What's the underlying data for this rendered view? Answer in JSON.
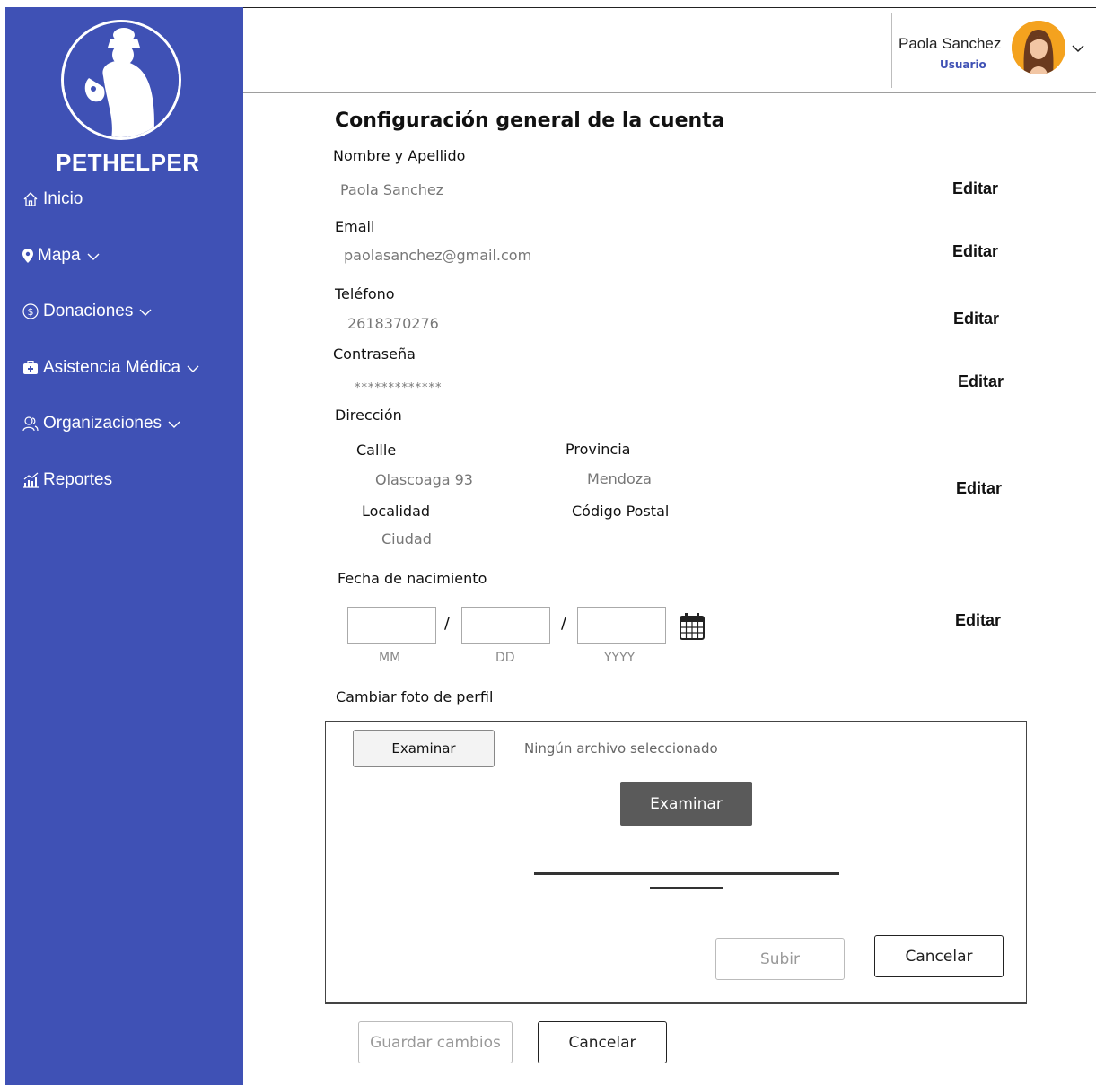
{
  "sidebar": {
    "logo_text": "PETHELPER",
    "items": [
      {
        "label": "Inicio",
        "icon": "home-icon"
      },
      {
        "label": "Mapa",
        "icon": "map-pin-icon"
      },
      {
        "label": "Donaciones",
        "icon": "dollar-coin-icon"
      },
      {
        "label": "Asistencia Médica",
        "icon": "medical-kit-icon"
      },
      {
        "label": "Organizaciones",
        "icon": "people-icon"
      },
      {
        "label": "Reportes",
        "icon": "chart-icon"
      }
    ]
  },
  "header": {
    "user_name": "Paola Sanchez",
    "user_role": "Usuario"
  },
  "main": {
    "title": "Configuración general de la cuenta",
    "name_label": "Nombre y Apellido",
    "name_value": "Paola Sanchez",
    "email_label": "Email",
    "email_value": "paolasanchez@gmail.com",
    "phone_label": "Teléfono",
    "phone_value": "2618370276",
    "password_label": "Contraseña",
    "password_value": "*************",
    "address_label": "Dirección",
    "street_label": "Callle",
    "street_value": "Olascoaga 93",
    "province_label": "Provincia",
    "province_value": "Mendoza",
    "locality_label": "Localidad",
    "locality_value": "Ciudad",
    "postal_label": "Código Postal",
    "birth_label": "Fecha de nacimiento",
    "date_sep": "/",
    "date_mm": "MM",
    "date_dd": "DD",
    "date_yyyy": "YYYY",
    "edit_label": "Editar",
    "photo_label": "Cambiar foto de perfil",
    "upload": {
      "file_button": "Examinar",
      "no_file": "Ningún archivo seleccionado",
      "browse_button": "Examinar",
      "upload_button": "Subir",
      "cancel_button": "Cancelar"
    },
    "save_button": "Guardar cambios",
    "cancel_button": "Cancelar"
  },
  "colors": {
    "sidebar": "#3f51b5",
    "role": "#3f51b5",
    "avatar_bg": "#f4a21e",
    "dark_button": "#5a5a5a"
  }
}
